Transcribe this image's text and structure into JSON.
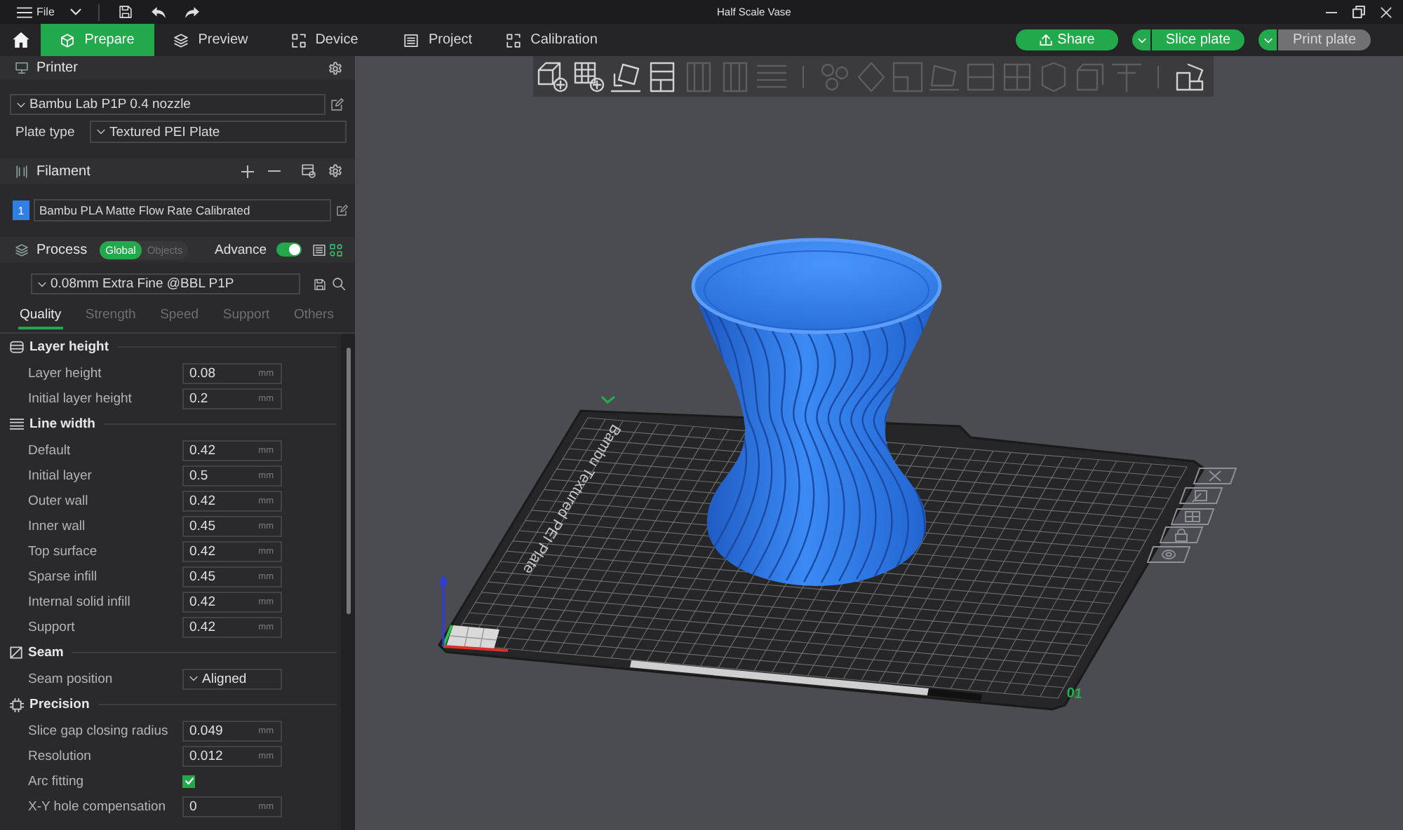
{
  "title_bar": {
    "menu": "File",
    "title": "Half Scale Vase"
  },
  "tabs": [
    {
      "label": "Prepare",
      "selected": true
    },
    {
      "label": "Preview",
      "selected": false
    },
    {
      "label": "Device",
      "selected": false
    },
    {
      "label": "Project",
      "selected": false
    },
    {
      "label": "Calibration",
      "selected": false
    }
  ],
  "actions": [
    {
      "kind": "icon",
      "label": "Share",
      "disabled": false
    },
    {
      "kind": "split",
      "label": "Slice plate",
      "disabled": false
    },
    {
      "kind": "split",
      "label": "Print plate",
      "disabled": true
    }
  ],
  "sidebar": {
    "printer": {
      "title": "Printer",
      "preset": "Bambu Lab P1P 0.4 nozzle",
      "plate_type": {
        "label": "Plate type",
        "value": "Textured PEI Plate"
      }
    },
    "filament": {
      "title": "Filament",
      "items": [
        {
          "number": "1",
          "name": "Bambu PLA Matte Flow Rate Calibrated",
          "color": "#2f7fe6"
        }
      ]
    },
    "process": {
      "title": "Process",
      "scopes": [
        {
          "label": "Global",
          "selected": true
        },
        {
          "label": "Objects",
          "selected": false
        }
      ],
      "advance": {
        "label": "Advance",
        "on": true
      },
      "preset": "0.08mm Extra Fine @BBL P1P"
    },
    "tabs": [
      {
        "label": "Quality",
        "selected": true
      },
      {
        "label": "Strength",
        "selected": false
      },
      {
        "label": "Speed",
        "selected": false
      },
      {
        "label": "Support",
        "selected": false
      },
      {
        "label": "Others",
        "selected": false
      }
    ],
    "groups": [
      {
        "title": "Layer height",
        "settings": [
          {
            "kind": "number",
            "label": "Layer height",
            "value": "0.08",
            "unit": "mm"
          },
          {
            "kind": "number",
            "label": "Initial layer height",
            "value": "0.2",
            "unit": "mm"
          }
        ]
      },
      {
        "title": "Line width",
        "settings": [
          {
            "kind": "number",
            "label": "Default",
            "value": "0.42",
            "unit": "mm"
          },
          {
            "kind": "number",
            "label": "Initial layer",
            "value": "0.5",
            "unit": "mm"
          },
          {
            "kind": "number",
            "label": "Outer wall",
            "value": "0.42",
            "unit": "mm"
          },
          {
            "kind": "number",
            "label": "Inner wall",
            "value": "0.45",
            "unit": "mm"
          },
          {
            "kind": "number",
            "label": "Top surface",
            "value": "0.42",
            "unit": "mm"
          },
          {
            "kind": "number",
            "label": "Sparse infill",
            "value": "0.45",
            "unit": "mm"
          },
          {
            "kind": "number",
            "label": "Internal solid infill",
            "value": "0.42",
            "unit": "mm"
          },
          {
            "kind": "number",
            "label": "Support",
            "value": "0.42",
            "unit": "mm"
          }
        ]
      },
      {
        "title": "Seam",
        "settings": [
          {
            "kind": "dropdown",
            "label": "Seam position",
            "value": "Aligned"
          }
        ]
      },
      {
        "title": "Precision",
        "settings": [
          {
            "kind": "number",
            "label": "Slice gap closing radius",
            "value": "0.049",
            "unit": "mm"
          },
          {
            "kind": "number",
            "label": "Resolution",
            "value": "0.012",
            "unit": "mm"
          },
          {
            "kind": "checkbox",
            "label": "Arc fitting",
            "checked": true
          },
          {
            "kind": "number",
            "label": "X-Y hole compensation",
            "value": "0",
            "unit": "mm"
          }
        ]
      }
    ]
  },
  "viewport": {
    "toolbar": {
      "groups": [
        {
          "tools": [
            {
              "disabled": false
            },
            {
              "disabled": false
            },
            {
              "disabled": false
            },
            {
              "disabled": false
            },
            {
              "disabled": true
            },
            {
              "disabled": true
            },
            {
              "disabled": true
            }
          ]
        },
        {
          "tools": [
            {
              "disabled": true
            },
            {
              "disabled": true
            },
            {
              "disabled": true
            },
            {
              "disabled": true
            },
            {
              "disabled": true
            },
            {
              "disabled": true
            },
            {
              "disabled": true
            },
            {
              "disabled": true
            },
            {
              "disabled": true
            }
          ]
        },
        {
          "tools": [
            {
              "disabled": false
            }
          ]
        }
      ]
    },
    "plate_label": "Bambu Textured PEI Plate",
    "plate_number": "01"
  }
}
